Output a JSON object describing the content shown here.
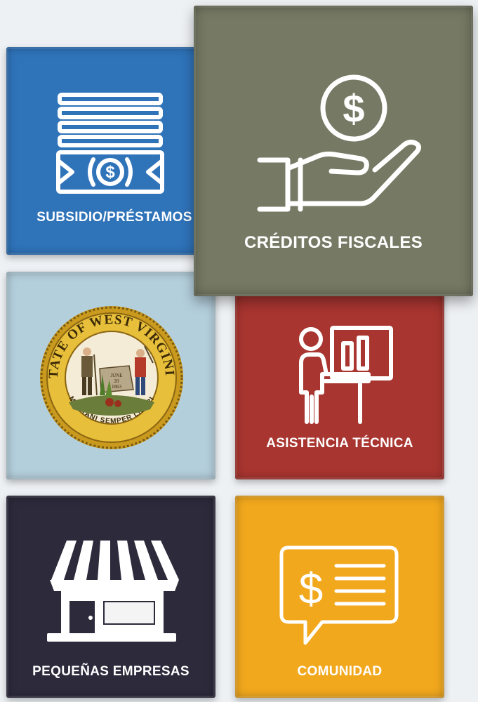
{
  "tiles": {
    "grants": {
      "label": "SUBSIDIO/PRÉSTAMOS",
      "color": "#2f73b9",
      "icon": "money-stack-icon"
    },
    "tax_credits": {
      "label": "CRÉDITOS FISCALES",
      "color": "#767a64",
      "icon": "hand-holding-coin-icon"
    },
    "state_seal": {
      "color": "#b4cfdc",
      "icon": "west-virginia-seal-icon",
      "seal_top_text": "STATE OF WEST VIRGINIA",
      "seal_bottom_text": "MONTANI SEMPER LIBERI",
      "seal_rock_text": "JUNE 20 1863"
    },
    "technical_assistance": {
      "label": "ASISTENCIA TÉCNICA",
      "color": "#a83530",
      "icon": "presenter-board-icon"
    },
    "small_business": {
      "label": "PEQUEÑAS EMPRESAS",
      "color": "#2c2a3b",
      "icon": "storefront-icon"
    },
    "community": {
      "label": "COMUNIDAD",
      "color": "#f2a81d",
      "icon": "speech-bubble-dollar-icon"
    }
  }
}
